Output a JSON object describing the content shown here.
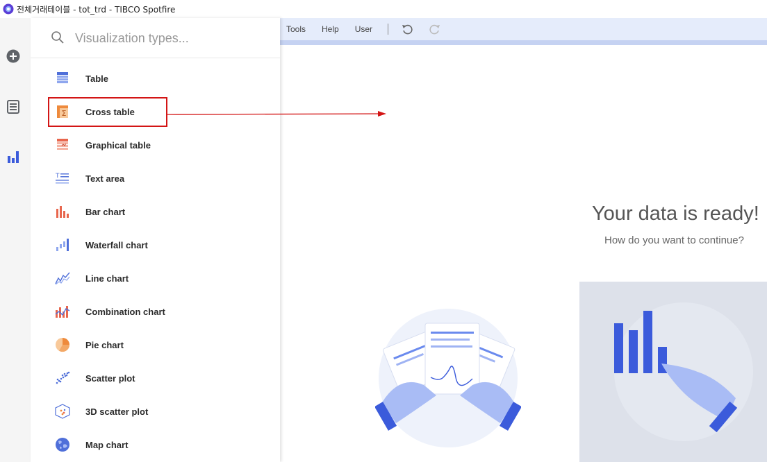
{
  "window": {
    "title": "전체거래테이블 - tot_trd - TIBCO Spotfire"
  },
  "rail": {
    "items": [
      {
        "icon": "add-circle-icon"
      },
      {
        "icon": "data-list-icon"
      },
      {
        "icon": "bar-chart-icon"
      }
    ]
  },
  "viz_panel": {
    "search_placeholder": "Visualization types...",
    "items": [
      {
        "label": "Table",
        "icon": "table-icon"
      },
      {
        "label": "Cross table",
        "icon": "cross-table-icon"
      },
      {
        "label": "Graphical table",
        "icon": "graphical-table-icon"
      },
      {
        "label": "Text area",
        "icon": "text-area-icon"
      },
      {
        "label": "Bar chart",
        "icon": "bar-chart-icon"
      },
      {
        "label": "Waterfall chart",
        "icon": "waterfall-chart-icon"
      },
      {
        "label": "Line chart",
        "icon": "line-chart-icon"
      },
      {
        "label": "Combination chart",
        "icon": "combination-chart-icon"
      },
      {
        "label": "Pie chart",
        "icon": "pie-chart-icon"
      },
      {
        "label": "Scatter plot",
        "icon": "scatter-plot-icon"
      },
      {
        "label": "3D scatter plot",
        "icon": "3d-scatter-plot-icon"
      },
      {
        "label": "Map chart",
        "icon": "map-chart-icon"
      }
    ]
  },
  "menubar": {
    "items": [
      "Tools",
      "Help",
      "User"
    ]
  },
  "main": {
    "title": "Your data is ready!",
    "subtitle": "How do you want to continue?"
  },
  "colors": {
    "accent_blue": "#3b5bdb",
    "annotation_red": "#d31515",
    "menubar_bg": "#e5ecfb"
  }
}
